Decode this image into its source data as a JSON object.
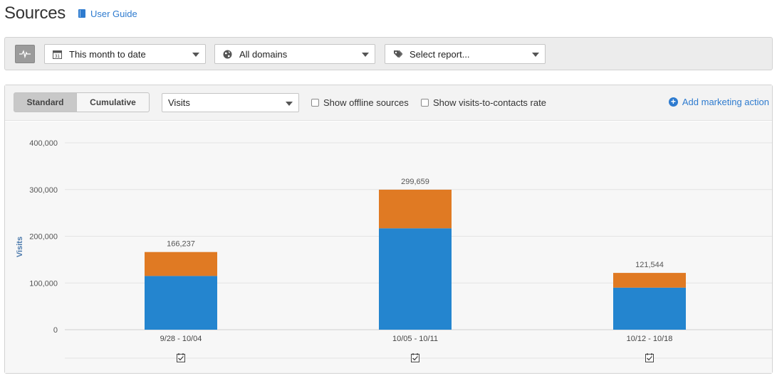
{
  "header": {
    "title": "Sources",
    "user_guide_label": "User Guide"
  },
  "filters": {
    "date_range": "This month to date",
    "domain": "All domains",
    "report_placeholder": "Select report..."
  },
  "toolbar": {
    "standard_label": "Standard",
    "cumulative_label": "Cumulative",
    "metric": "Visits",
    "offline_sources_label": "Show offline sources",
    "visits_to_contacts_label": "Show visits-to-contacts rate",
    "add_marketing_action_label": "Add marketing action"
  },
  "colors": {
    "series_blue": "#2485cf",
    "series_orange": "#e07a23",
    "accent": "#2e7bcf"
  },
  "chart_data": {
    "type": "bar",
    "stacked": true,
    "categories": [
      "9/28 - 10/04",
      "10/05 - 10/11",
      "10/12 - 10/18"
    ],
    "series": [
      {
        "color": "#2485cf",
        "values": [
          115000,
          217000,
          90000
        ]
      },
      {
        "color": "#e07a23",
        "values": [
          51237,
          82659,
          31544
        ]
      }
    ],
    "totals": [
      "166,237",
      "299,659",
      "121,544"
    ],
    "ylabel": "Visits",
    "xlabel": "",
    "ylim": [
      0,
      400000
    ],
    "yticks": [
      0,
      100000,
      200000,
      300000,
      400000
    ],
    "ytick_labels": [
      "0",
      "100,000",
      "200,000",
      "300,000",
      "400,000"
    ],
    "grid": true
  }
}
